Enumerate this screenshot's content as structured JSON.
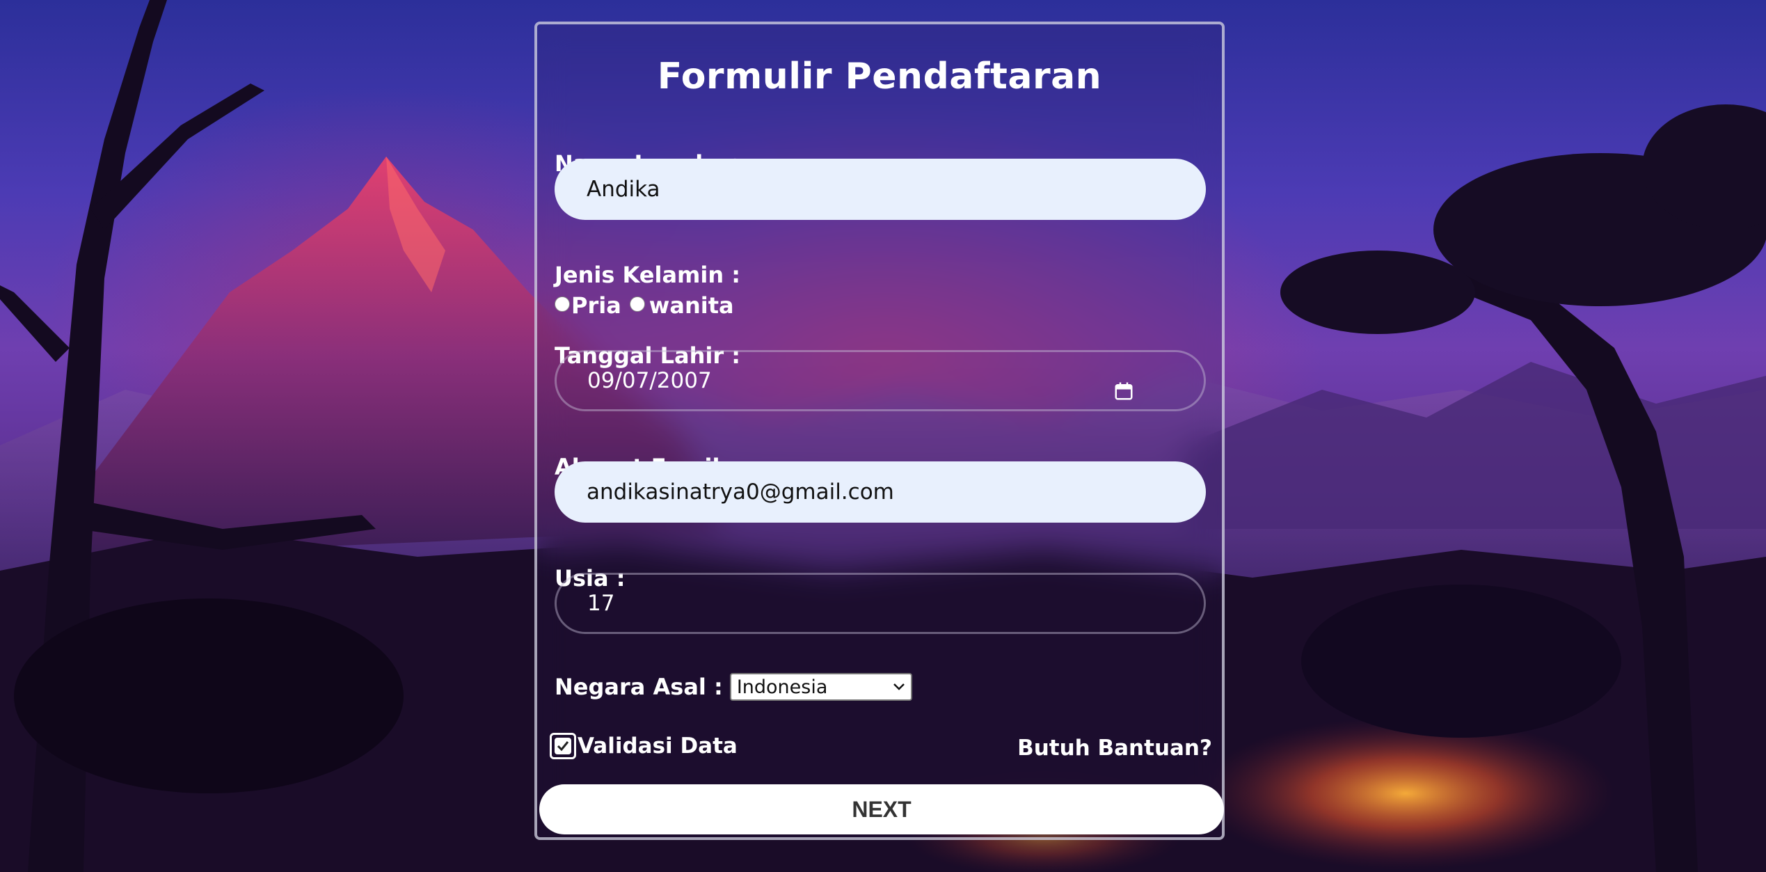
{
  "colors": {
    "input_light_bg": "#e8f0fd",
    "button_bg": "#ffffff",
    "button_text": "#333333",
    "card_border": "#d7d7e6"
  },
  "form": {
    "title": "Formulir Pendaftaran",
    "name": {
      "label": "Nama Lengkap :",
      "value": "Andika"
    },
    "gender": {
      "label": "Jenis Kelamin :",
      "options": [
        "Pria",
        "wanita"
      ],
      "selected": null
    },
    "birthdate": {
      "label": "Tanggal Lahir :",
      "value": "09/07/2007",
      "icon": "calendar-icon"
    },
    "email": {
      "label": "Alamat Email :",
      "value": "andikasinatrya0@gmail.com"
    },
    "age": {
      "label": "Usia :",
      "value": "17"
    },
    "country": {
      "label": "Negara Asal :",
      "selected": "Indonesia",
      "icon": "chevron-down-icon"
    },
    "validate": {
      "label": "Validasi Data",
      "checked": true
    },
    "help_link": "Butuh Bantuan?",
    "next_button": "NEXT"
  }
}
